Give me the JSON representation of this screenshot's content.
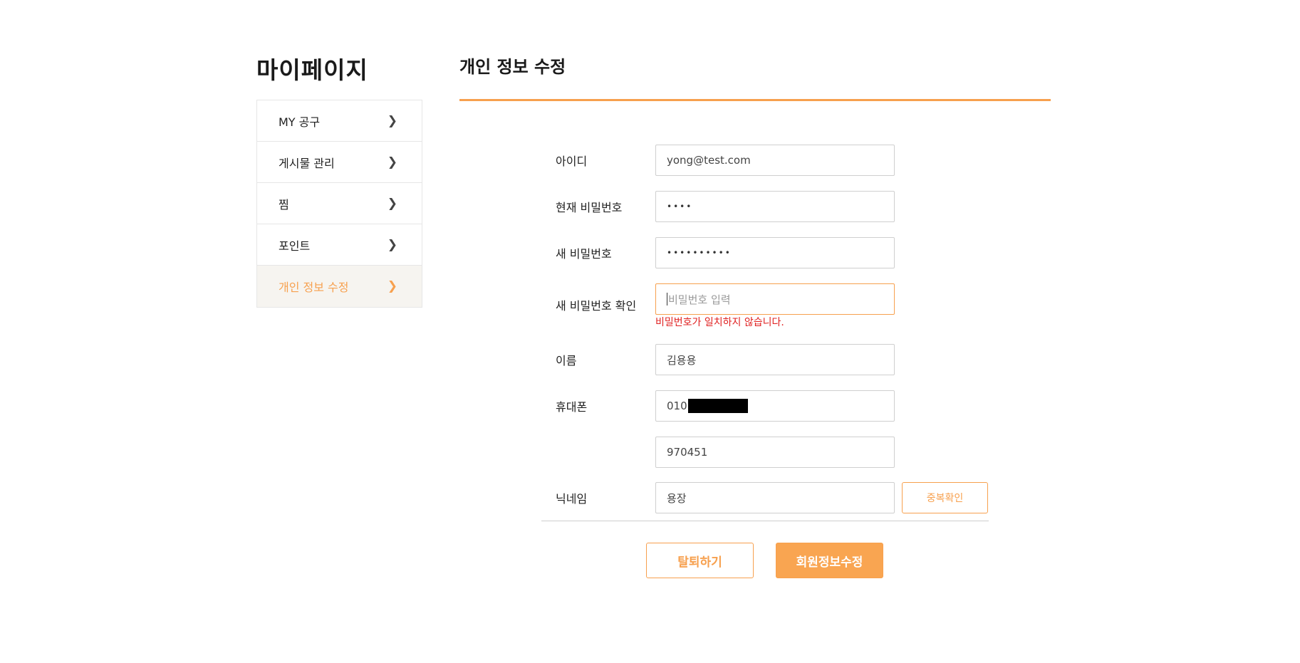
{
  "sidebar": {
    "title": "마이페이지",
    "items": [
      {
        "label": "MY 공구"
      },
      {
        "label": "게시물 관리"
      },
      {
        "label": "찜"
      },
      {
        "label": "포인트"
      },
      {
        "label": "개인 정보 수정"
      }
    ]
  },
  "main": {
    "title": "개인 정보 수정",
    "fields": {
      "id": {
        "label": "아이디",
        "value": "yong@test.com"
      },
      "current_password": {
        "label": "현재 비밀번호",
        "value": "••••"
      },
      "new_password": {
        "label": "새 비밀번호",
        "value": "••••••••••"
      },
      "confirm_password": {
        "label": "새 비밀번호 확인",
        "placeholder": "비밀번호 입력",
        "error": "비밀번호가 일치하지 않습니다."
      },
      "name": {
        "label": "이름",
        "value": "김용용"
      },
      "phone": {
        "label": "휴대폰",
        "value": "010"
      },
      "phone_code": {
        "value": "970451"
      },
      "nickname": {
        "label": "닉네임",
        "value": "용장",
        "check_button": "중복확인"
      }
    },
    "buttons": {
      "withdraw": "탈퇴하기",
      "submit": "회원정보수정"
    }
  },
  "colors": {
    "accent": "#f7a04e",
    "error": "#e02020"
  }
}
